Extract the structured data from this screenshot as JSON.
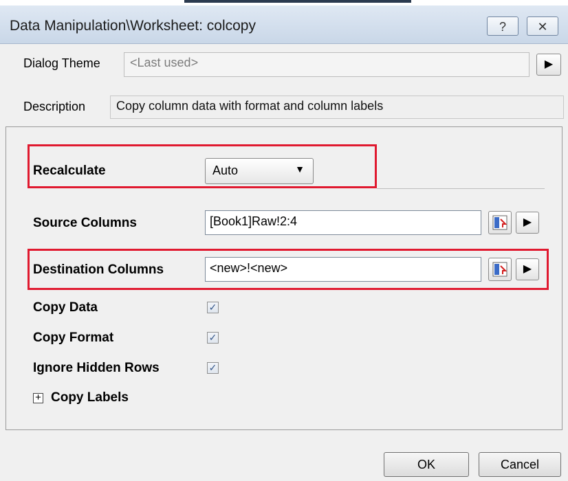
{
  "window": {
    "title": "Data Manipulation\\Worksheet: colcopy",
    "help_glyph": "?",
    "close_glyph": "✕"
  },
  "theme": {
    "label": "Dialog Theme",
    "value": "<Last used>"
  },
  "description": {
    "label": "Description",
    "value": "Copy column data with format and column labels"
  },
  "recalculate": {
    "label": "Recalculate",
    "value": "Auto"
  },
  "source": {
    "label": "Source Columns",
    "value": "[Book1]Raw!2:4"
  },
  "destination": {
    "label": "Destination Columns",
    "value": "<new>!<new>"
  },
  "options": [
    {
      "label": "Copy Data",
      "checked": true
    },
    {
      "label": "Copy Format",
      "checked": true
    },
    {
      "label": "Ignore Hidden Rows",
      "checked": true
    }
  ],
  "labels_group": {
    "label": "Copy Labels",
    "expander_glyph": "+"
  },
  "buttons": {
    "ok": "OK",
    "cancel": "Cancel"
  },
  "colors": {
    "highlight": "#e0192f"
  }
}
